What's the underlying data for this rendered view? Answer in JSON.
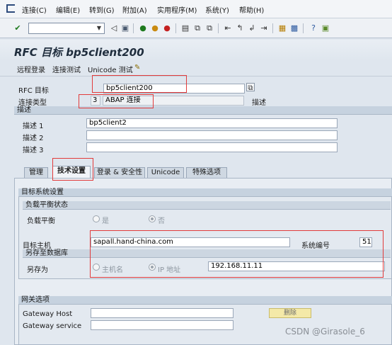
{
  "menu": {
    "items": [
      "连接(C)",
      "编辑(E)",
      "转到(G)",
      "附加(A)",
      "实用程序(M)",
      "系统(Y)",
      "帮助(H)"
    ]
  },
  "toolbar": {
    "command_value": "",
    "icons": [
      "checkmark-icon",
      "dropdown-icon",
      "back-icon",
      "save-icon",
      "navigate-back-icon",
      "exit-icon",
      "cancel-icon",
      "print-icon",
      "find-icon",
      "find-next-icon",
      "first-page-icon",
      "prev-page-icon",
      "next-page-icon",
      "last-page-icon",
      "new-session-icon",
      "shortcut-icon",
      "help-icon",
      "customize-icon"
    ]
  },
  "title": "RFC 目标 bp5client200",
  "app_toolbar": {
    "remote_login": "远程登录",
    "connection_test": "连接测试",
    "unicode_test": "Unicode 测试"
  },
  "header": {
    "rfc_dest_label": "RFC 目标",
    "rfc_dest_value": "bp5client200",
    "conn_type_label": "连接类型",
    "conn_type_code": "3",
    "conn_type_desc": "ABAP 连接",
    "desc_label": "描述"
  },
  "description": {
    "header": "描述",
    "rows": [
      {
        "label": "描述 1",
        "value": "bp5client2"
      },
      {
        "label": "描述 2",
        "value": ""
      },
      {
        "label": "描述 3",
        "value": ""
      }
    ]
  },
  "tabs": [
    "管理",
    "技术设置",
    "登录 & 安全性",
    "Unicode",
    "特殊选项"
  ],
  "target_system": {
    "header": "目标系统设置",
    "load_balance_header": "负载平衡状态",
    "load_balance_label": "负载平衡",
    "yes": "是",
    "no": "否",
    "target_host_label": "目标主机",
    "target_host_value": "sapall.hand-china.com",
    "system_number_label": "系统编号",
    "system_number_value": "51",
    "save_to_db_header": "另存至数据库",
    "save_as_label": "另存为",
    "hostname_option": "主机名",
    "ip_option": "IP 地址",
    "ip_value": "192.168.11.11"
  },
  "gateway": {
    "header": "网关选项",
    "host_label": "Gateway Host",
    "host_value": "",
    "service_label": "Gateway service",
    "service_value": "",
    "delete_button": "删除"
  },
  "watermark": "CSDN @Girasole_6"
}
